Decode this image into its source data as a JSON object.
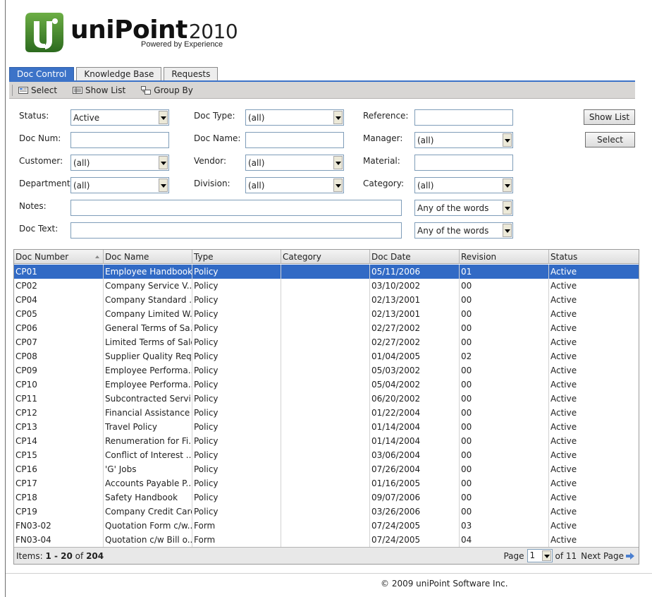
{
  "app": {
    "logo_name": "uniPoint",
    "logo_year": "2010",
    "logo_tagline": "Powered by Experience",
    "brand_green": "#3a7d2a",
    "accent_blue": "#316ac5"
  },
  "tabs": [
    {
      "label": "Doc Control",
      "active": true
    },
    {
      "label": "Knowledge Base",
      "active": false
    },
    {
      "label": "Requests",
      "active": false
    }
  ],
  "toolbar": {
    "select_label": "Select",
    "show_list_label": "Show List",
    "group_by_label": "Group By"
  },
  "filters": {
    "status": {
      "label": "Status:",
      "value": "Active"
    },
    "doc_type": {
      "label": "Doc Type:",
      "value": "(all)"
    },
    "reference": {
      "label": "Reference:",
      "value": ""
    },
    "doc_num": {
      "label": "Doc Num:",
      "value": ""
    },
    "doc_name": {
      "label": "Doc Name:",
      "value": ""
    },
    "manager": {
      "label": "Manager:",
      "value": "(all)"
    },
    "customer": {
      "label": "Customer:",
      "value": "(all)"
    },
    "vendor": {
      "label": "Vendor:",
      "value": "(all)"
    },
    "material": {
      "label": "Material:",
      "value": ""
    },
    "department": {
      "label": "Department:",
      "value": "(all)"
    },
    "division": {
      "label": "Division:",
      "value": "(all)"
    },
    "category": {
      "label": "Category:",
      "value": "(all)"
    },
    "notes": {
      "label": "Notes:",
      "value": "",
      "match": "Any of the words"
    },
    "doc_text": {
      "label": "Doc Text:",
      "value": "",
      "match": "Any of the words"
    }
  },
  "buttons": {
    "show_list": "Show List",
    "select": "Select"
  },
  "grid": {
    "columns": [
      "Doc Number",
      "Doc Name",
      "Type",
      "Category",
      "Doc Date",
      "Revision",
      "Status"
    ],
    "sorted_column": "Doc Number",
    "selected_row": 0,
    "rows": [
      [
        "CP01",
        "Employee Handbook",
        "Policy",
        "",
        "05/11/2006",
        "01",
        "Active"
      ],
      [
        "CP02",
        "Company Service V...",
        "Policy",
        "",
        "03/10/2002",
        "00",
        "Active"
      ],
      [
        "CP04",
        "Company Standard ...",
        "Policy",
        "",
        "02/13/2001",
        "00",
        "Active"
      ],
      [
        "CP05",
        "Company Limited W...",
        "Policy",
        "",
        "02/13/2001",
        "00",
        "Active"
      ],
      [
        "CP06",
        "General Terms of Sa...",
        "Policy",
        "",
        "02/27/2002",
        "00",
        "Active"
      ],
      [
        "CP07",
        "Limited Terms of Sale",
        "Policy",
        "",
        "02/27/2002",
        "00",
        "Active"
      ],
      [
        "CP08",
        "Supplier Quality Req...",
        "Policy",
        "",
        "01/04/2005",
        "02",
        "Active"
      ],
      [
        "CP09",
        "Employee Performa...",
        "Policy",
        "",
        "05/03/2002",
        "00",
        "Active"
      ],
      [
        "CP10",
        "Employee Performa...",
        "Policy",
        "",
        "05/04/2002",
        "00",
        "Active"
      ],
      [
        "CP11",
        "Subcontracted Servi...",
        "Policy",
        "",
        "06/20/2002",
        "00",
        "Active"
      ],
      [
        "CP12",
        "Financial Assistance i...",
        "Policy",
        "",
        "01/22/2004",
        "00",
        "Active"
      ],
      [
        "CP13",
        "Travel Policy",
        "Policy",
        "",
        "01/14/2004",
        "00",
        "Active"
      ],
      [
        "CP14",
        "Renumeration for Fi...",
        "Policy",
        "",
        "01/14/2004",
        "00",
        "Active"
      ],
      [
        "CP15",
        "Conflict of Interest ...",
        "Policy",
        "",
        "03/06/2004",
        "00",
        "Active"
      ],
      [
        "CP16",
        "'G' Jobs",
        "Policy",
        "",
        "07/26/2004",
        "00",
        "Active"
      ],
      [
        "CP17",
        "Accounts Payable P...",
        "Policy",
        "",
        "01/16/2005",
        "00",
        "Active"
      ],
      [
        "CP18",
        "Safety Handbook",
        "Policy",
        "",
        "09/07/2006",
        "00",
        "Active"
      ],
      [
        "CP19",
        "Company Credit Cards",
        "Policy",
        "",
        "03/26/2006",
        "00",
        "Active"
      ],
      [
        "FN03-02",
        "Quotation Form c/w...",
        "Form",
        "",
        "07/24/2005",
        "03",
        "Active"
      ],
      [
        "FN03-04",
        "Quotation c/w Bill o...",
        "Form",
        "",
        "07/24/2005",
        "04",
        "Active"
      ]
    ]
  },
  "footer": {
    "items_prefix": "Items:",
    "items_range": "1 - 20",
    "items_of": "of",
    "items_total": "204",
    "page_label": "Page",
    "page_value": "1",
    "page_of": "of 11",
    "next_label": "Next Page"
  },
  "copyright": "© 2009 uniPoint Software Inc."
}
